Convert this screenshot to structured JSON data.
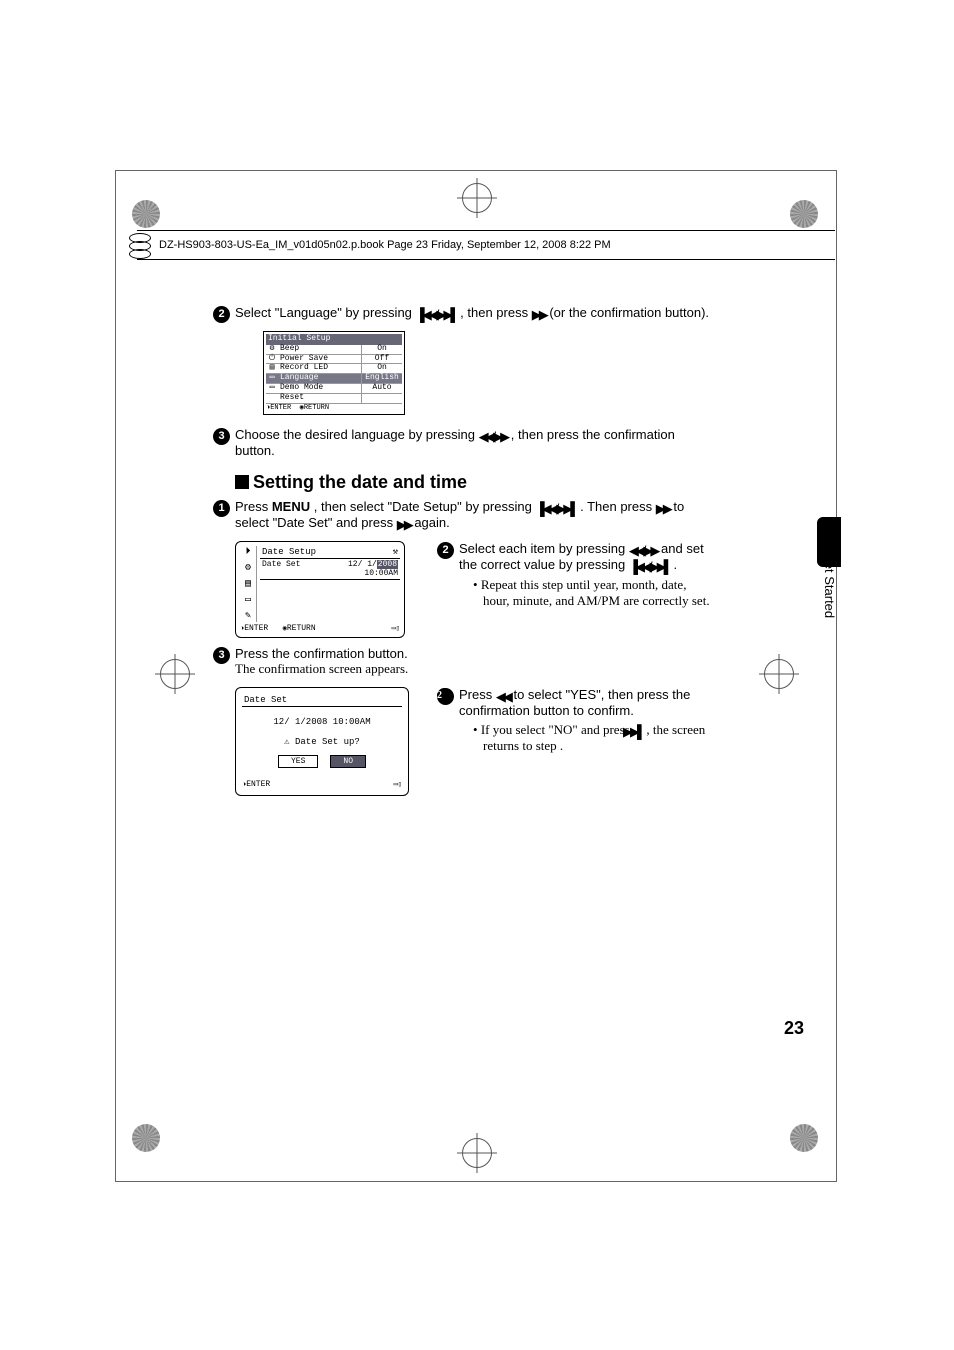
{
  "header": "DZ-HS903-803-US-Ea_IM_v01d05n02.p.book  Page 23  Friday, September 12, 2008  8:22 PM",
  "step2_top": "Select \"Language\" by pressing ",
  "step2_top_b": ", then press ",
  "step2_top_c": " (or the confirmation button).",
  "menu1": {
    "title": "Initial Setup",
    "rows": [
      {
        "label": "Beep",
        "val": "On"
      },
      {
        "label": "Power Save",
        "val": "Off"
      },
      {
        "label": "Record LED",
        "val": "On"
      },
      {
        "label": "Language",
        "val": "English",
        "sel": true
      },
      {
        "label": "Demo Mode",
        "val": "Auto"
      },
      {
        "label": "Reset",
        "val": ""
      }
    ],
    "foot_l": "ENTER",
    "foot_m": "RETURN"
  },
  "step3_top": "Choose the desired language by pressing ",
  "step3_top_b": ", then press the confirmation button.",
  "heading": "Setting the date and time",
  "step1_a": "Press ",
  "step1_menu": "MENU",
  "step1_b": ", then select \"Date Setup\" by pressing ",
  "step1_c": ". Then press ",
  "step1_d": " to select \"Date Set\" and press ",
  "step1_e": " again.",
  "menu2": {
    "title": "Date Setup",
    "row_label": "Date Set",
    "row_date": "12/ 1/",
    "row_year": "2008",
    "row_time": "10:00AM",
    "foot_enter": "ENTER",
    "foot_return": "RETURN"
  },
  "step2r_a": "Select each item by pressing ",
  "step2r_b": " and set the correct value by pressing ",
  "step2r_c": ".",
  "step2r_bullet": "Repeat this step until year, month, date, hour, minute, and AM/PM are correctly set.",
  "step3b_a": "Press the confirmation button.",
  "step3b_b": "The confirmation screen appears.",
  "menu3": {
    "title": "Date Set",
    "datetime": "12/ 1/2008 10:00AM",
    "prompt": "Date Set up?",
    "yes": "YES",
    "no": "NO",
    "foot_enter": "ENTER"
  },
  "step4_a": "Press ",
  "step4_b": " to select \"YES\", then press the confirmation button to confirm.",
  "step4_bullet_a": "If you select \"NO\" and press ",
  "step4_bullet_b": ", the screen returns to step ",
  "step4_bullet_c": ".",
  "side_tab": "Let's Get Started",
  "page_num": "23"
}
